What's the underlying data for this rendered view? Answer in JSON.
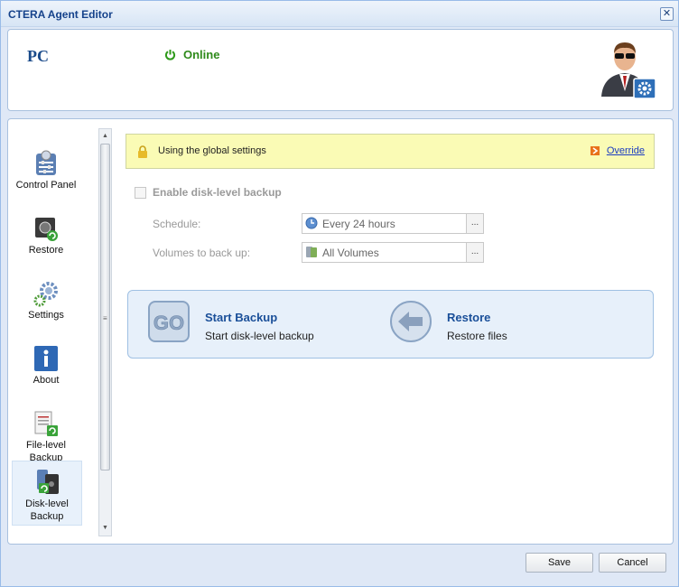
{
  "window": {
    "title": "CTERA Agent Editor"
  },
  "header": {
    "device_name": "PC",
    "status": "Online"
  },
  "nav": {
    "items": [
      {
        "label": "Control Panel",
        "icon": "control-panel-icon"
      },
      {
        "label": "Restore",
        "icon": "restore-safe-icon"
      },
      {
        "label": "Settings",
        "icon": "settings-gears-icon"
      },
      {
        "label": "About",
        "icon": "info-icon"
      },
      {
        "label": "File-level Backup",
        "icon": "file-backup-icon"
      },
      {
        "label": "Disk-level Backup",
        "icon": "disk-backup-icon",
        "selected": true
      }
    ]
  },
  "content": {
    "banner": {
      "text": "Using the global settings",
      "link": "Override"
    },
    "enable_checkbox": {
      "label": "Enable disk-level backup",
      "checked": false,
      "disabled": true
    },
    "schedule": {
      "label": "Schedule:",
      "value": "Every 24 hours",
      "button": "..."
    },
    "volumes": {
      "label": "Volumes to back up:",
      "value": "All Volumes",
      "button": "..."
    },
    "actions": [
      {
        "title": "Start Backup",
        "subtitle": "Start disk-level backup",
        "icon_text": "GO"
      },
      {
        "title": "Restore",
        "subtitle": "Restore files",
        "icon": "back-arrow-icon"
      }
    ]
  },
  "footer": {
    "save": "Save",
    "cancel": "Cancel"
  },
  "colors": {
    "accent": "#1a4f99",
    "online": "#2f8a1b",
    "banner": "#fafbb5"
  }
}
